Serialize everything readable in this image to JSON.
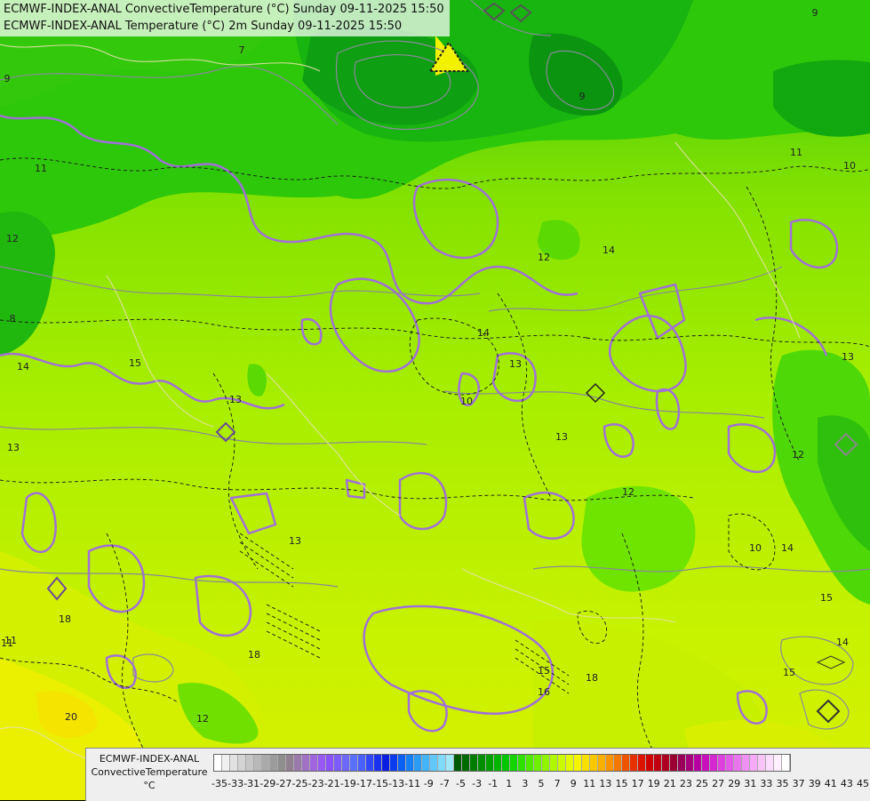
{
  "titles": {
    "line1": "ECMWF-INDEX-ANAL ConvectiveTemperature (°C) Sunday 09-11-2025 15:50",
    "line2": "ECMWF-INDEX-ANAL Temperature (°C) 2m Sunday 09-11-2025 15:50"
  },
  "legend": {
    "model": "ECMWF-INDEX-ANAL",
    "variable": "ConvectiveTemperature",
    "unit": "°C",
    "tick_labels": [
      "-35",
      "-33",
      "-31",
      "-29",
      "-27",
      "-25",
      "-23",
      "-21",
      "-19",
      "-17",
      "-15",
      "-13",
      "-11",
      "-9",
      "-7",
      "-5",
      "-3",
      "-1",
      "1",
      "3",
      "5",
      "7",
      "9",
      "11",
      "13",
      "15",
      "17",
      "19",
      "21",
      "23",
      "25",
      "27",
      "29",
      "31",
      "33",
      "35",
      "37",
      "39",
      "41",
      "43",
      "45"
    ],
    "colors": [
      "#ffffff",
      "#f0f0f0",
      "#e2e2e2",
      "#d4d4d4",
      "#c6c6c6",
      "#b8b8b8",
      "#aaaaaa",
      "#9c9c9c",
      "#8e8e8e",
      "#908090",
      "#9a7aaa",
      "#a071c4",
      "#a064de",
      "#9858f2",
      "#8a50fa",
      "#7c5cfa",
      "#6e68fa",
      "#5a70fc",
      "#4a60fc",
      "#3248f8",
      "#1a32f0",
      "#0a1ee0",
      "#0a3cee",
      "#0a60f2",
      "#1480f4",
      "#2a9cf6",
      "#44b4f8",
      "#62c8fa",
      "#80daf9",
      "#a0e8f7",
      "#005a00",
      "#006a00",
      "#007c00",
      "#008e00",
      "#00a000",
      "#00b400",
      "#00c600",
      "#14d400",
      "#2ee000",
      "#4eea00",
      "#6ef000",
      "#90f400",
      "#b0f800",
      "#ccfa00",
      "#e4fa00",
      "#f6f600",
      "#f8e000",
      "#f8c800",
      "#f8b000",
      "#f89400",
      "#f47800",
      "#ee5400",
      "#e63000",
      "#dc1400",
      "#d00000",
      "#c00010",
      "#ae0020",
      "#9c0030",
      "#980058",
      "#a8007c",
      "#b800a0",
      "#c810bc",
      "#d428d0",
      "#de40e0",
      "#e45ae8",
      "#ea74ee",
      "#f090f2",
      "#f4aaf6",
      "#f8c4f8",
      "#fcdcfc",
      "#fef0fe",
      "#ffffff"
    ]
  },
  "isolines": [
    "9",
    "9",
    "9",
    "7",
    "8",
    "11",
    "11",
    "12",
    "12",
    "13",
    "13",
    "14",
    "14",
    "14",
    "15",
    "15",
    "15",
    "13",
    "13",
    "13",
    "13",
    "12",
    "10",
    "10",
    "11",
    "12",
    "14",
    "14",
    "15",
    "16",
    "18",
    "18",
    "20",
    "12",
    "18",
    "10",
    "11"
  ]
}
